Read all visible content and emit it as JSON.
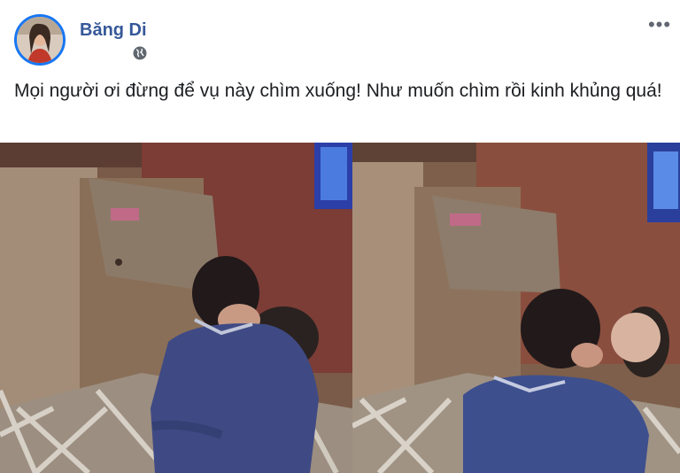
{
  "post": {
    "author_name": "Băng Di",
    "privacy_icon": "globe-icon",
    "more_icon": "more-options-icon",
    "more_glyph": "•••",
    "text": "Mọi người ơi đừng để vụ này chìm xuống! Như muốn chìm rồi kinh khủng quá!"
  },
  "media": {
    "frames": [
      {
        "name": "cctv-frame-1"
      },
      {
        "name": "cctv-frame-2"
      }
    ]
  },
  "colors": {
    "author_link": "#365899",
    "text": "#1c1e21",
    "secondary": "#606770",
    "avatar_ring": "#1877f2"
  }
}
